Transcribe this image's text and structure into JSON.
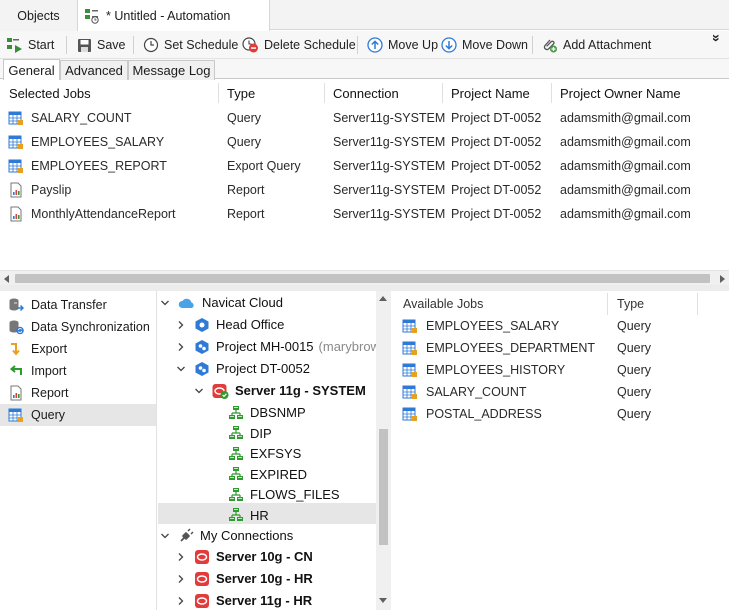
{
  "tabs": [
    {
      "label": "Objects"
    },
    {
      "label": "* Untitled - Automation"
    }
  ],
  "toolbar": {
    "start": "Start",
    "save": "Save",
    "set_schedule": "Set Schedule",
    "delete_schedule": "Delete Schedule",
    "move_up": "Move Up",
    "move_down": "Move Down",
    "add_attachment": "Add Attachment",
    "overflow": "»"
  },
  "subtabs": [
    "General",
    "Advanced",
    "Message Log"
  ],
  "jobs_table": {
    "columns": [
      "Selected Jobs",
      "Type",
      "Connection",
      "Project Name",
      "Project Owner Name"
    ],
    "rows": [
      {
        "name": "SALARY_COUNT",
        "type": "Query",
        "connection": "Server11g-SYSTEM",
        "project": "Project DT-0052",
        "owner": "adamsmith@gmail.com",
        "icon": "query-icon"
      },
      {
        "name": "EMPLOYEES_SALARY",
        "type": "Query",
        "connection": "Server11g-SYSTEM",
        "project": "Project DT-0052",
        "owner": "adamsmith@gmail.com",
        "icon": "query-icon"
      },
      {
        "name": "EMPLOYEES_REPORT",
        "type": "Export Query",
        "connection": "Server11g-SYSTEM",
        "project": "Project DT-0052",
        "owner": "adamsmith@gmail.com",
        "icon": "query-icon"
      },
      {
        "name": "Payslip",
        "type": "Report",
        "connection": "Server11g-SYSTEM",
        "project": "Project DT-0052",
        "owner": "adamsmith@gmail.com",
        "icon": "report-icon"
      },
      {
        "name": "MonthlyAttendanceReport",
        "type": "Report",
        "connection": "Server11g-SYSTEM",
        "project": "Project DT-0052",
        "owner": "adamsmith@gmail.com",
        "icon": "report-icon"
      }
    ]
  },
  "job_types": [
    {
      "label": "Data Transfer",
      "icon": "data-transfer-icon"
    },
    {
      "label": "Data Synchronization",
      "icon": "data-sync-icon"
    },
    {
      "label": "Export",
      "icon": "export-icon"
    },
    {
      "label": "Import",
      "icon": "import-icon"
    },
    {
      "label": "Report",
      "icon": "report-icon"
    },
    {
      "label": "Query",
      "icon": "query-icon",
      "selected": true
    }
  ],
  "tree": {
    "navicat_cloud": "Navicat Cloud",
    "head_office": "Head Office",
    "project_mh": "Project MH-0015",
    "project_mh_owner": "(marybrown",
    "project_dt": "Project DT-0052",
    "server_11g_system": "Server 11g - SYSTEM",
    "schemas": [
      "DBSNMP",
      "DIP",
      "EXFSYS",
      "EXPIRED",
      "FLOWS_FILES",
      "HR"
    ],
    "my_connections": "My Connections",
    "connections": [
      "Server 10g - CN",
      "Server 10g - HR",
      "Server 11g - HR"
    ]
  },
  "available_jobs": {
    "columns": [
      "Available Jobs",
      "Type"
    ],
    "rows": [
      {
        "name": "EMPLOYEES_SALARY",
        "type": "Query"
      },
      {
        "name": "EMPLOYEES_DEPARTMENT",
        "type": "Query"
      },
      {
        "name": "EMPLOYEES_HISTORY",
        "type": "Query"
      },
      {
        "name": "SALARY_COUNT",
        "type": "Query"
      },
      {
        "name": "POSTAL_ADDRESS",
        "type": "Query"
      }
    ]
  },
  "colors": {
    "accent_blue": "#2f7ad6",
    "oracle_red": "#e23b3b",
    "schema_green": "#2e9b2e",
    "selection": "#e6e6e6"
  }
}
